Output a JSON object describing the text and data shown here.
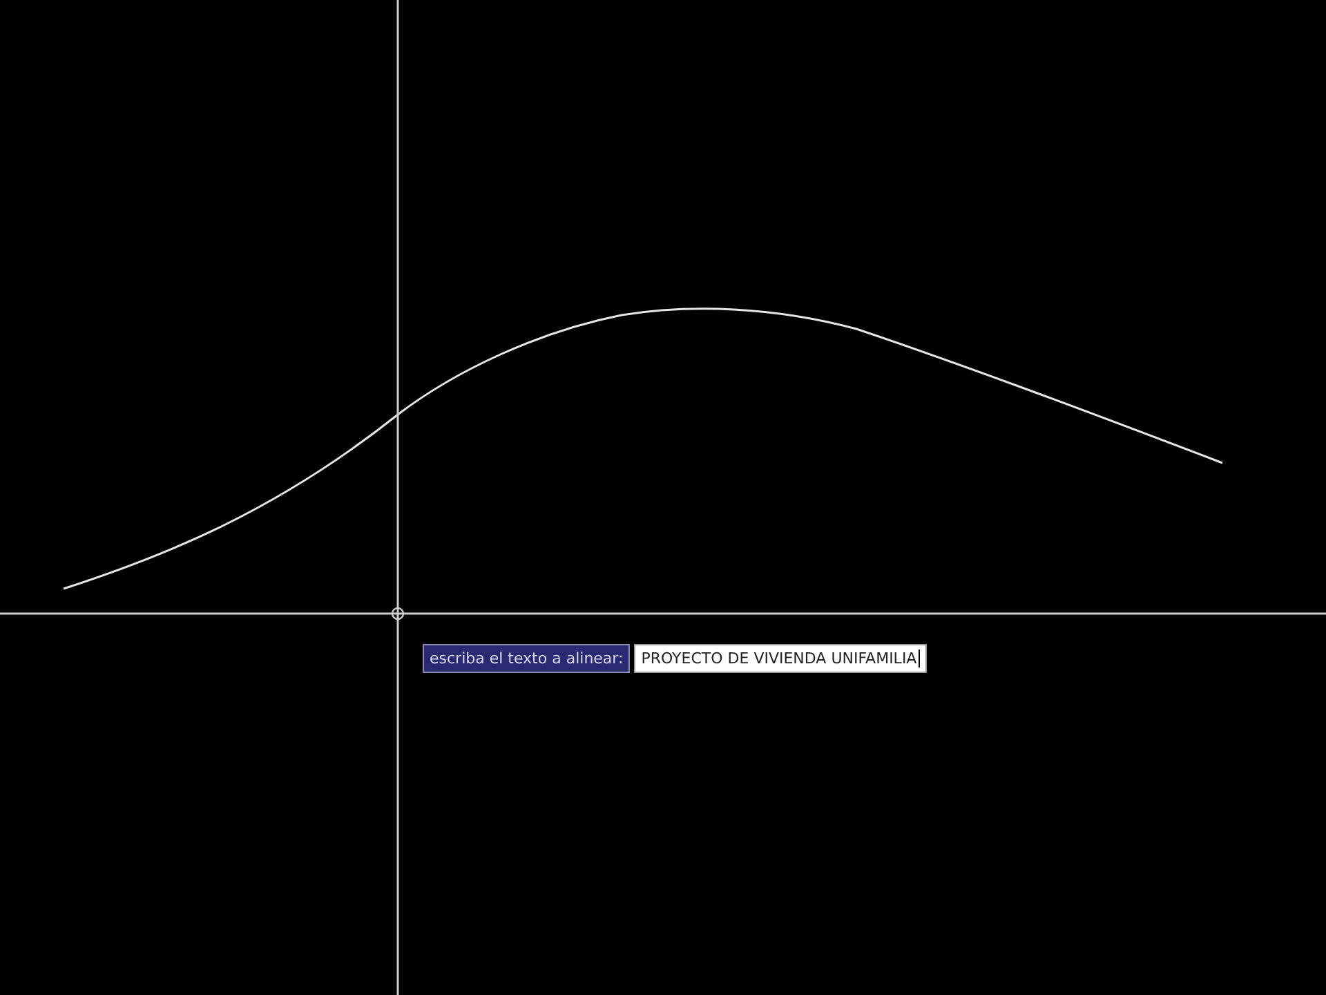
{
  "dynamic_input": {
    "prompt": "escriba el texto a alinear:",
    "value": "PROYECTO DE VIVIENDA UNIFAMILIA"
  }
}
